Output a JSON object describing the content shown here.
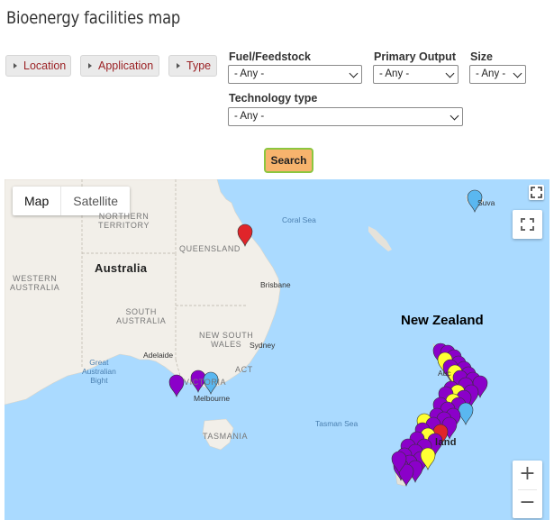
{
  "page": {
    "title": "Bioenergy facilities map"
  },
  "filters": {
    "buttons": [
      "Location",
      "Application",
      "Type"
    ],
    "fuel": {
      "label": "Fuel/Feedstock",
      "value": "- Any -"
    },
    "output": {
      "label": "Primary Output",
      "value": "- Any -"
    },
    "size": {
      "label": "Size",
      "value": "- Any -"
    },
    "tech": {
      "label": "Technology type",
      "value": "- Any -"
    },
    "search_label": "Search"
  },
  "map": {
    "type_buttons": {
      "map": "Map",
      "satellite": "Satellite"
    },
    "labels": {
      "northern_territory": "NORTHERN\nTERRITORY",
      "queensland": "QUEENSLAND",
      "western_australia": "WESTERN\nAUSTRALIA",
      "australia": "Australia",
      "south_australia": "SOUTH\nAUSTRALIA",
      "new_south_wales": "NEW SOUTH\nWALES",
      "victoria": "VICTORIA",
      "act": "ACT",
      "tasmania": "TASMANIA",
      "great_australian_bight": "Great\nAustralian\nBight",
      "coral_sea": "Coral Sea",
      "tasman_sea": "Tasman Sea",
      "brisbane": "Brisbane",
      "sydney": "Sydney",
      "adelaide": "Adelaide",
      "melbourne": "Melbourne",
      "suva": "Suva",
      "new_zealand": "New Zealand",
      "auckland_partial": "Auc",
      "nz_island_partial": "land"
    },
    "colors": {
      "water": "#aadaff",
      "land": "#f2efe9",
      "purple_marker": "#8b00c9",
      "yellow_marker": "#ffff33",
      "blue_marker": "#5ab7f0",
      "red_marker": "#e0252a"
    }
  }
}
